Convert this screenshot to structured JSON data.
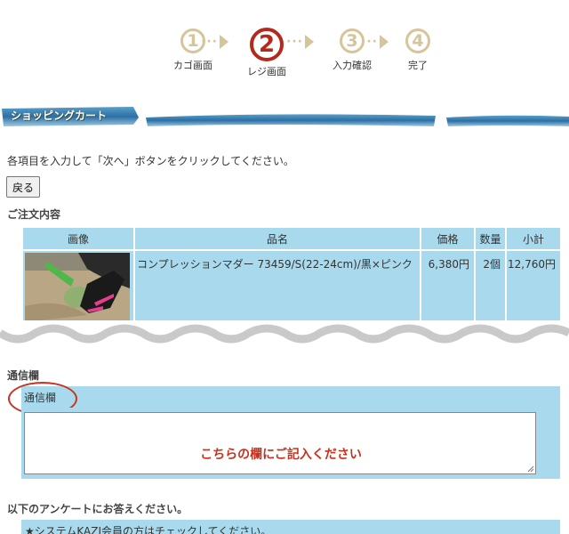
{
  "steps": [
    {
      "num": "1",
      "label": "カゴ画面"
    },
    {
      "num": "2",
      "label": "レジ画面"
    },
    {
      "num": "3",
      "label": "入力確認"
    },
    {
      "num": "4",
      "label": "完了"
    }
  ],
  "page_title": "ショッピングカート",
  "instruction": "各項目を入力して「次へ」ボタンをクリックしてください。",
  "back_button": "戻る",
  "order_heading": "ご注文内容",
  "order_table": {
    "headers": [
      "画像",
      "品名",
      "価格",
      "数量",
      "小計"
    ],
    "rows": [
      {
        "name": "コンプレッションマダー 73459/S(22-24cm)/黒×ピンク",
        "price": "6,380円",
        "qty": "2個",
        "subtotal": "12,760円"
      }
    ]
  },
  "comment_heading": "通信欄",
  "comment_label": "通信欄",
  "comment_hint": "こちらの欄にご記入ください",
  "survey_heading": "以下のアンケートにお答えください。",
  "survey_first_item": "★システムKAZI会員の方はチェックしてください。",
  "colors": {
    "accent_red": "#c8321e",
    "step_gold": "#d6c59a",
    "table_blue": "#a9d9ec"
  }
}
